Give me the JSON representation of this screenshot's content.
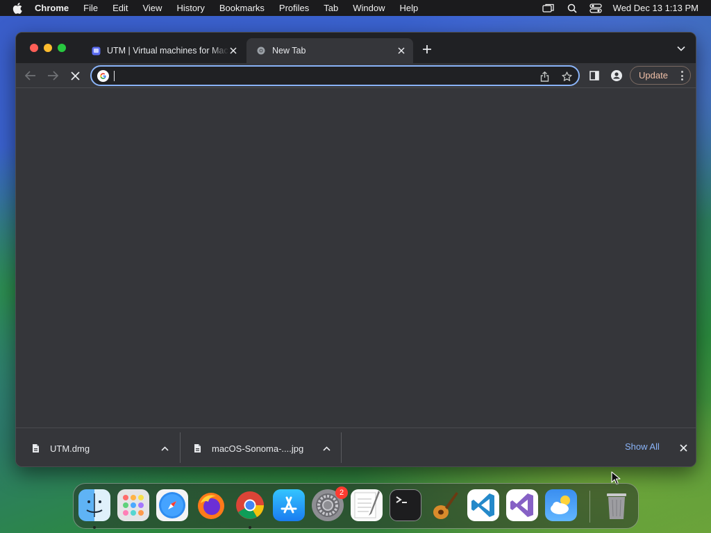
{
  "menubar": {
    "app_name": "Chrome",
    "items": [
      "File",
      "Edit",
      "View",
      "History",
      "Bookmarks",
      "Profiles",
      "Tab",
      "Window",
      "Help"
    ],
    "clock": "Wed Dec 13  1:13 PM"
  },
  "tabs": [
    {
      "title": "UTM | Virtual machines for Mac",
      "favicon": "utm-icon",
      "active": false
    },
    {
      "title": "New Tab",
      "favicon": "chrome-icon",
      "active": true
    }
  ],
  "omnibox": {
    "value": "",
    "placeholder": ""
  },
  "toolbar": {
    "update_label": "Update"
  },
  "downloads": {
    "items": [
      {
        "filename": "UTM.dmg"
      },
      {
        "filename": "macOS-Sonoma-....jpg"
      }
    ],
    "show_all_label": "Show All"
  },
  "dock": {
    "apps": [
      "Finder",
      "Launchpad",
      "Safari",
      "Firefox",
      "Chrome",
      "App Store",
      "System Settings",
      "TextEdit",
      "Terminal",
      "GarageBand",
      "Visual Studio Code",
      "Visual Studio",
      "Weather",
      "Trash"
    ],
    "settings_badge": "2"
  },
  "colors": {
    "accent": "#8ab4f8",
    "tab_strip": "#202124",
    "window_bg": "#35363a",
    "update_text": "#f0c0a8"
  }
}
